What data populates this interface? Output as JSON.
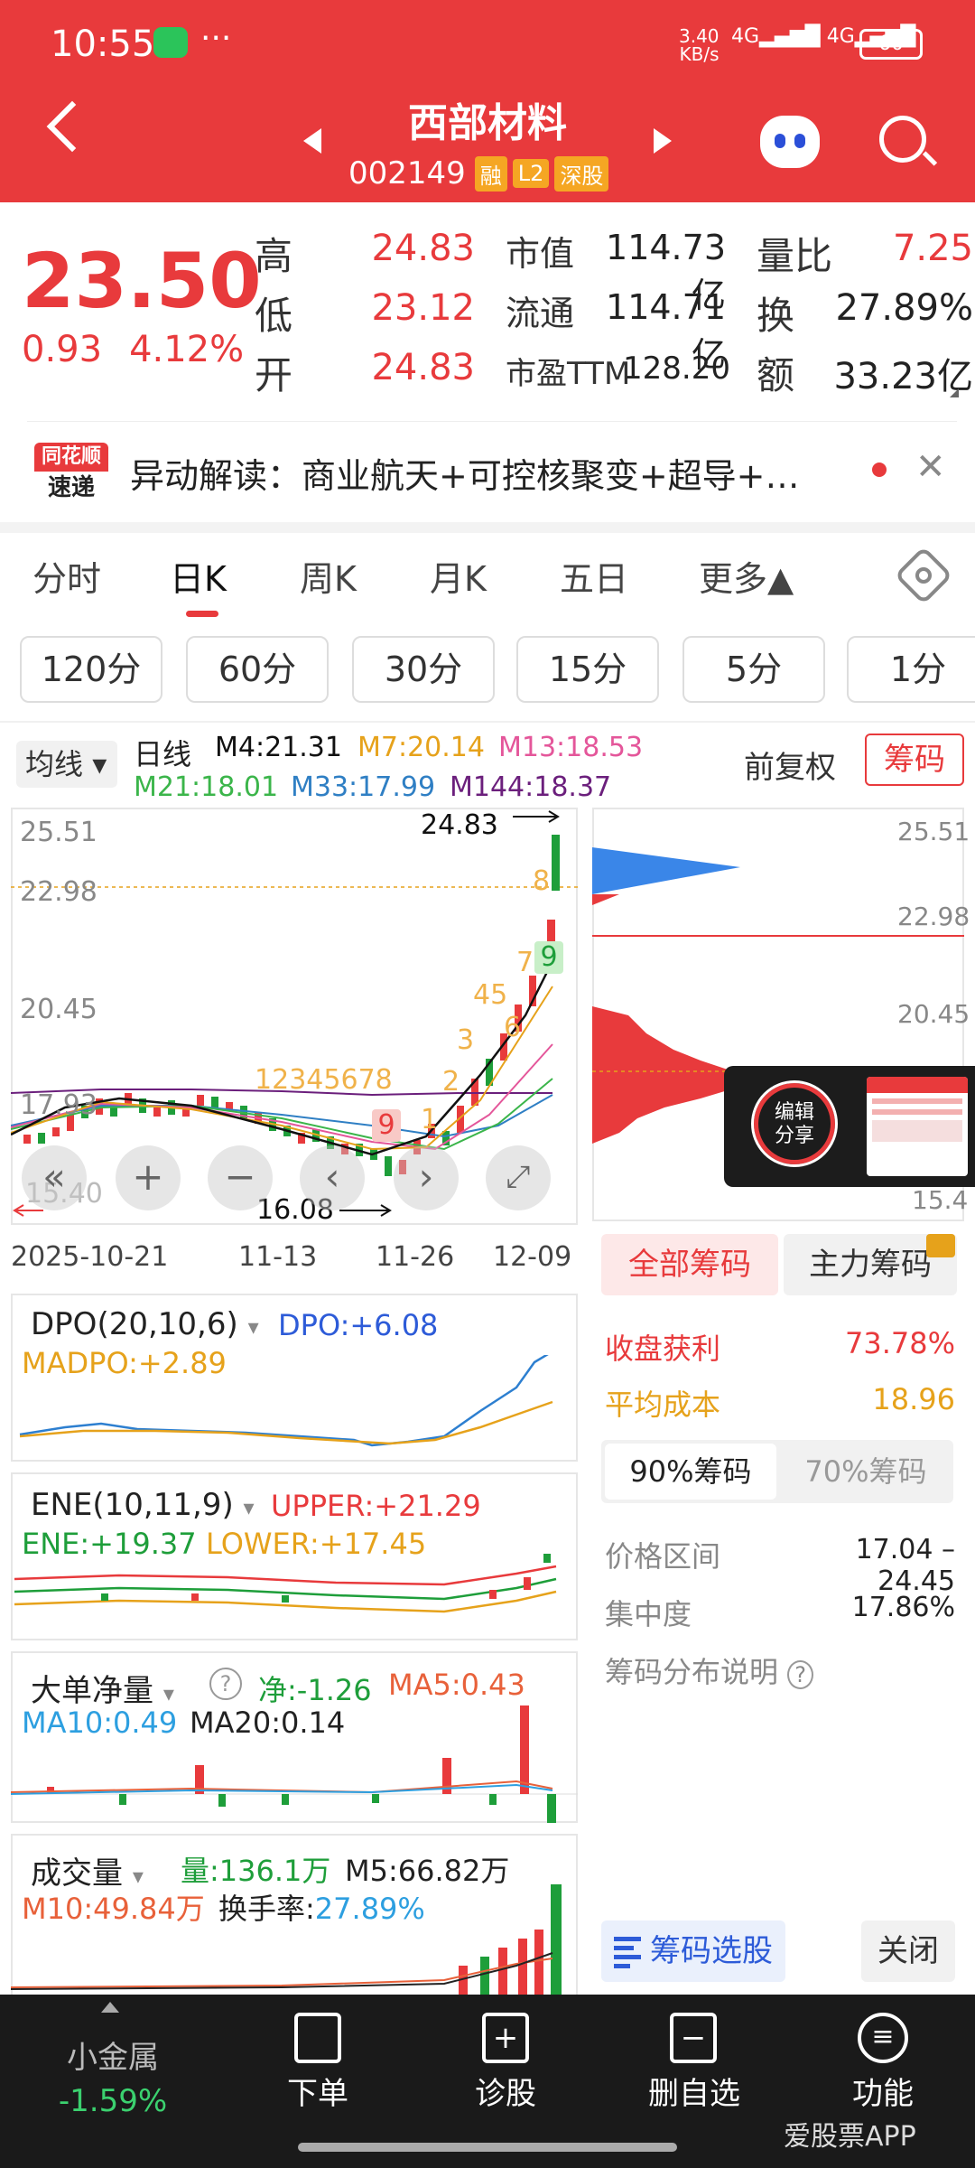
{
  "status": {
    "time": "10:55",
    "more": "···",
    "net_speed": "3.40",
    "net_unit": "KB/s",
    "signal1": "4G",
    "signal2": "4G",
    "battery": "60"
  },
  "header": {
    "name": "西部材料",
    "code": "002149",
    "badges": [
      "融",
      "L2",
      "深股"
    ]
  },
  "quote": {
    "price": "23.50",
    "change": "0.93",
    "change_pct": "4.12%",
    "rows": [
      {
        "l1": "高",
        "v1": "24.83",
        "l2": "市值",
        "v2": "114.73亿",
        "l3": "量比",
        "v3": "7.25"
      },
      {
        "l1": "低",
        "v1": "23.12",
        "l2": "流通",
        "v2": "114.71亿",
        "l3": "换",
        "v3": "27.89%"
      },
      {
        "l1": "开",
        "v1": "24.83",
        "l2": "市盈TTM",
        "v2": "128.20",
        "l3": "额",
        "v3": "33.23亿"
      }
    ]
  },
  "news": {
    "logo_top": "同花顺",
    "logo_bottom": "速递",
    "text": "异动解读：商业航天+可控核聚变+超导+…"
  },
  "tabs": [
    "分时",
    "日K",
    "周K",
    "月K",
    "五日",
    "更多▲"
  ],
  "periods": [
    "120分",
    "60分",
    "30分",
    "15分",
    "5分",
    "1分"
  ],
  "ma_legend": {
    "selector": "均线",
    "type": "日线",
    "items": [
      {
        "label": "M4:21.31",
        "color": "#111111"
      },
      {
        "label": "M7:20.14",
        "color": "#e6a21b"
      },
      {
        "label": "M13:18.53",
        "color": "#e4569a"
      },
      {
        "label": "M21:18.01",
        "color": "#3bb54a"
      },
      {
        "label": "M33:17.99",
        "color": "#2f7fc4"
      },
      {
        "label": "M144:18.37",
        "color": "#6b1f7c"
      }
    ],
    "adjust": "前复权",
    "chip_button": "筹码"
  },
  "kline": {
    "y_labels": [
      "25.51",
      "22.98",
      "20.45",
      "17.93",
      "15.40"
    ],
    "x_labels": [
      "2025-10-21",
      "11-13",
      "11-26",
      "12-09"
    ],
    "high_mark": "24.83",
    "low_mark": "16.08",
    "up_tags": [
      "1",
      "2",
      "3",
      "4",
      "5",
      "6",
      "7",
      "8",
      "9"
    ],
    "down_tags": [
      "1",
      "2",
      "3",
      "4",
      "5",
      "6",
      "7",
      "8",
      "9"
    ]
  },
  "chip_chart": {
    "y_labels": [
      "25.51",
      "22.98",
      "20.45",
      "15.4"
    ]
  },
  "dpo": {
    "selector": "DPO(20,10,6)",
    "dpo": "DPO:+6.08",
    "madpo": "MADPO:+2.89"
  },
  "ene": {
    "selector": "ENE(10,11,9)",
    "upper": "UPPER:+21.29",
    "ene": "ENE:+19.37",
    "lower": "LOWER:+17.45"
  },
  "big_order": {
    "selector": "大单净量",
    "net": "净:-1.26",
    "ma5": "MA5:0.43",
    "ma10": "MA10:0.49",
    "ma20": "MA20:0.14"
  },
  "volume": {
    "selector": "成交量",
    "vol": "量:136.1万",
    "m5": "M5:66.82万",
    "m10": "M10:49.84万",
    "turnover_label": "换手率:",
    "turnover": "27.89%"
  },
  "chip_panel": {
    "tab_all": "全部筹码",
    "tab_main": "主力筹码",
    "profit_label": "收盘获利",
    "profit": "73.78%",
    "cost_label": "平均成本",
    "cost": "18.96",
    "seg_on": "90%筹码",
    "seg_off": "70%筹码",
    "range_label": "价格区间",
    "range": "17.04 – 24.45",
    "conc_label": "集中度",
    "conc": "17.86%",
    "help": "筹码分布说明",
    "pick": "筹码选股",
    "close": "关闭"
  },
  "share": {
    "line1": "编辑",
    "line2": "分享"
  },
  "bottom_nav": {
    "sector_name": "小金属",
    "sector_change": "-1.59%",
    "items": [
      "下单",
      "诊股",
      "删自选",
      "功能"
    ]
  },
  "watermark": "爱股票APP"
}
